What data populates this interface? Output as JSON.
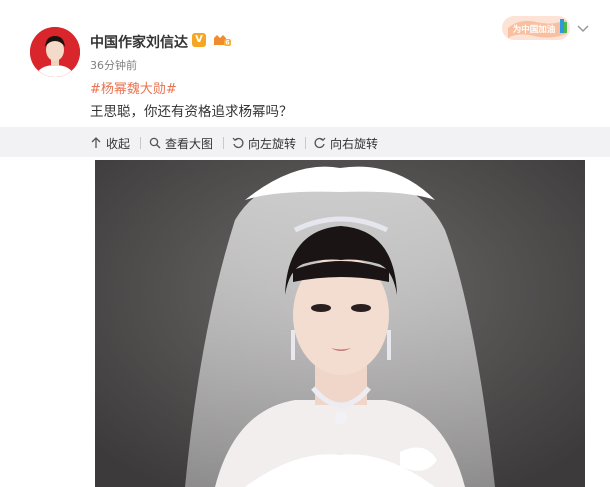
{
  "post": {
    "author": "中国作家刘信达",
    "time": "36分钟前",
    "topic": "#杨幂魏大勋#",
    "text": "王思聪，你还有资格追求杨幂吗？",
    "verified_badge": "V"
  },
  "toolbar": {
    "collapse": "收起",
    "view_large": "查看大图",
    "rotate_left": "向左旋转",
    "rotate_right": "向右旋转"
  },
  "campaign_badge": "为中国加油",
  "colors": {
    "topic": "#eb7350",
    "toolbar_bg": "#f2f2f5",
    "verified": "#f5a623"
  }
}
